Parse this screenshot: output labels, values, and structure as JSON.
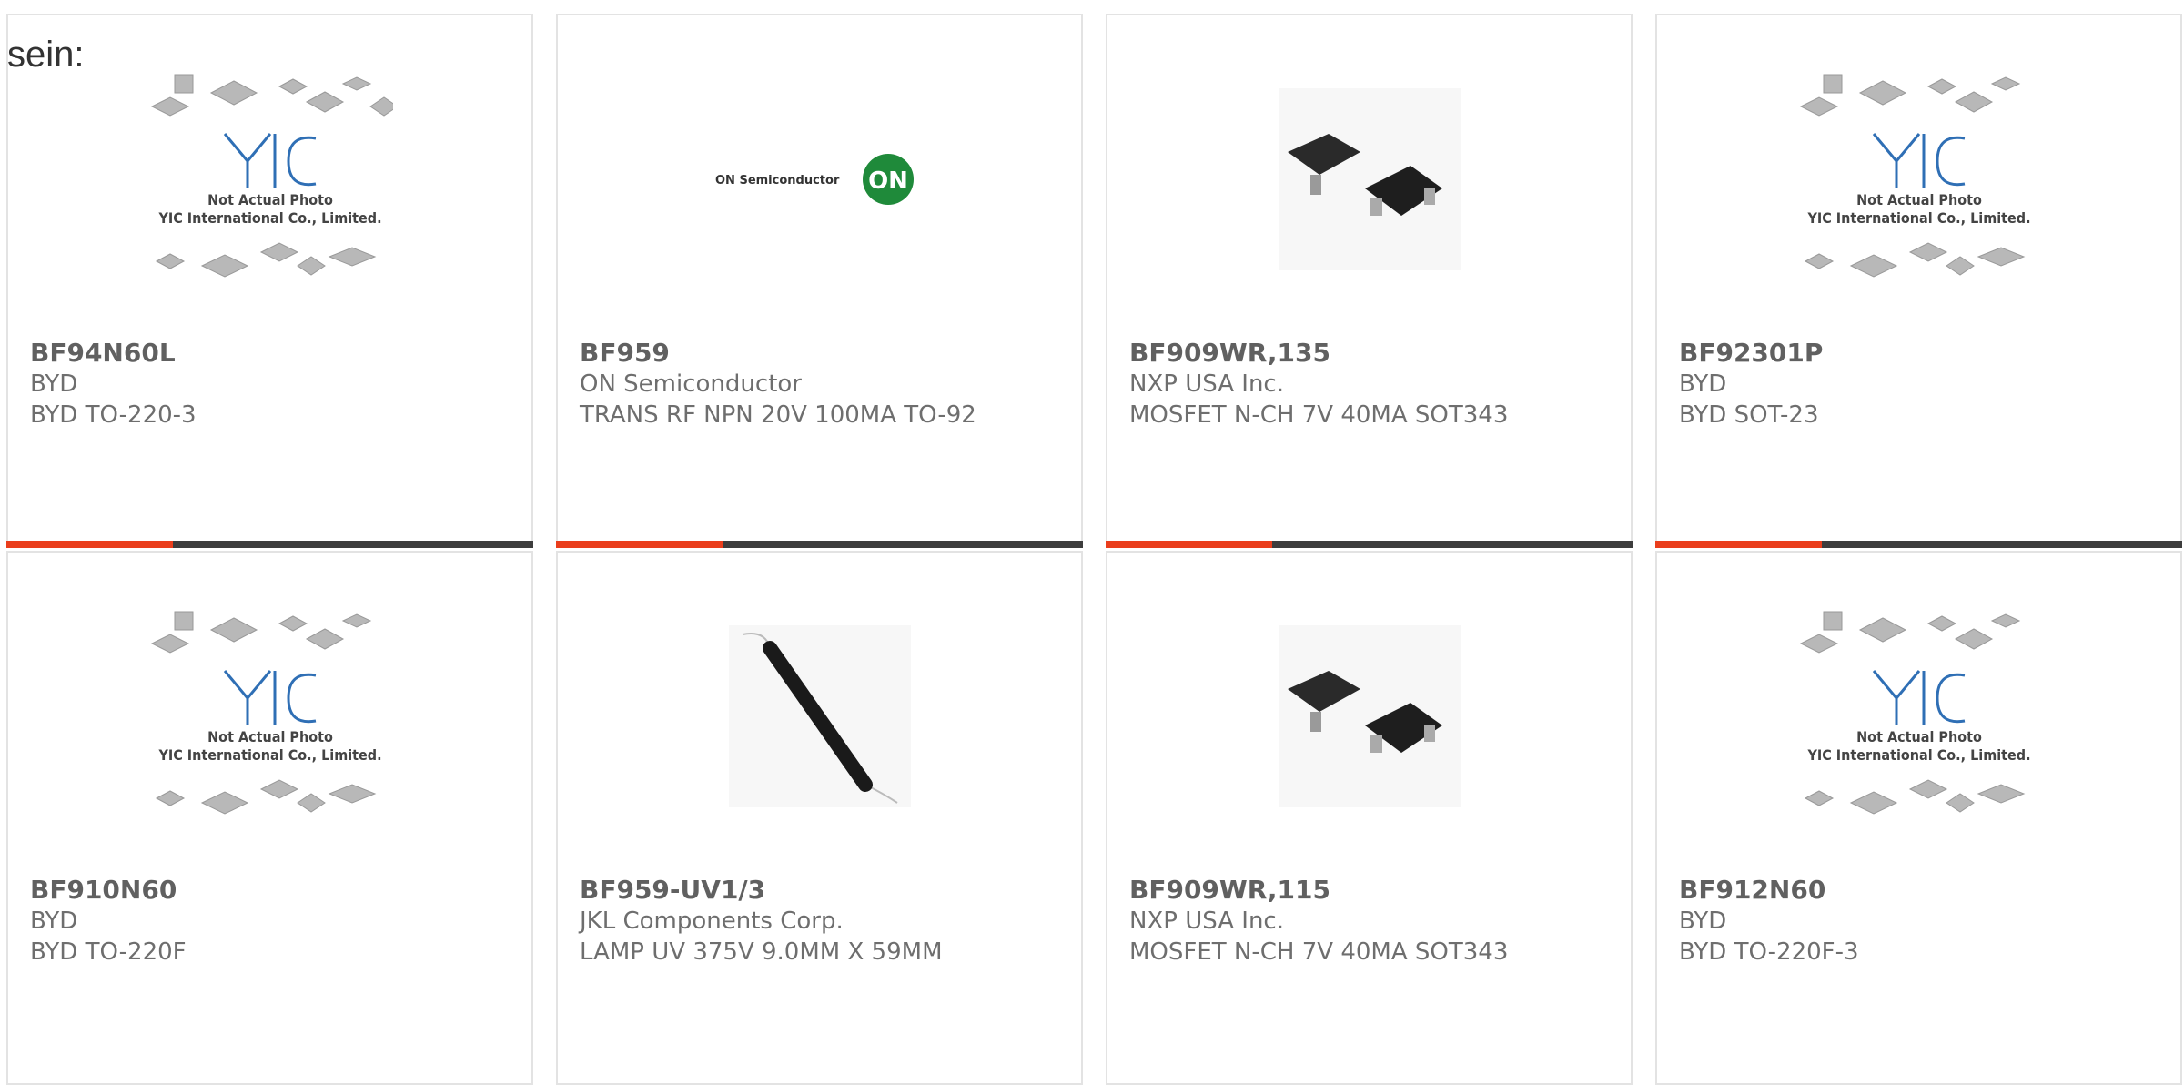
{
  "intro": "sein:",
  "placeholder": {
    "line1": "Not Actual Photo",
    "line2": "YIC International Co., Limited."
  },
  "on_logo_text": "ON Semiconductor",
  "on_badge": "ON",
  "products": [
    {
      "part": "BF94N60L",
      "maker": "BYD",
      "desc": "BYD TO-220-3",
      "image": "yic-placeholder"
    },
    {
      "part": "BF959",
      "maker": "ON Semiconductor",
      "desc": "TRANS RF NPN 20V 100MA TO-92",
      "image": "on-semiconductor-logo"
    },
    {
      "part": "BF909WR,135",
      "maker": "NXP USA Inc.",
      "desc": "MOSFET N-CH 7V 40MA SOT343",
      "image": "sot343-photo"
    },
    {
      "part": "BF92301P",
      "maker": "BYD",
      "desc": "BYD SOT-23",
      "image": "yic-placeholder"
    },
    {
      "part": "BF910N60",
      "maker": "BYD",
      "desc": "BYD TO-220F",
      "image": "yic-placeholder"
    },
    {
      "part": "BF959-UV1/3",
      "maker": "JKL Components Corp.",
      "desc": "LAMP UV 375V 9.0MM X 59MM",
      "image": "uv-lamp-photo"
    },
    {
      "part": "BF909WR,115",
      "maker": "NXP USA Inc.",
      "desc": "MOSFET N-CH 7V 40MA SOT343",
      "image": "sot343-photo"
    },
    {
      "part": "BF912N60",
      "maker": "BYD",
      "desc": "BYD TO-220F-3",
      "image": "yic-placeholder"
    }
  ],
  "colors": {
    "accent": "#ea3e1c",
    "bar": "#3d3d3d",
    "border": "#e3e3e3",
    "yic_blue": "#2f6fb5",
    "on_green": "#1f8a3a"
  }
}
